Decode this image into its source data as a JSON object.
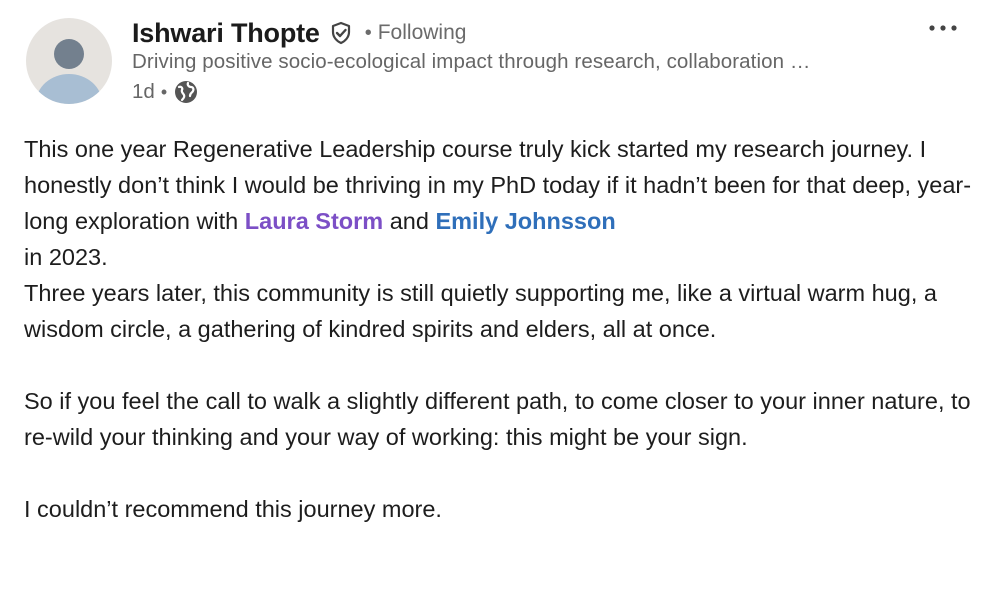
{
  "author": {
    "name": "Ishwari Thopte",
    "following": "Following",
    "headline": "Driving positive socio-ecological impact through research, collaboration …",
    "time": "1d",
    "verified_icon": "verified-shield-icon",
    "visibility_icon": "globe-icon"
  },
  "menu": {
    "more_icon": "more-horizontal-icon"
  },
  "post": {
    "p1_a": "This one year Regenerative Leadership course truly kick started my research journey. I honestly don’t think I would be thriving in my PhD today if it hadn’t been for that deep, year-long exploration with ",
    "mention_1": "Laura Storm",
    "p1_b": " and ",
    "mention_2": "Emily Johnsson",
    "p1_c": " in 2023.",
    "p2": "Three years later, this community is still quietly supporting me, like a virtual warm hug, a wisdom circle, a gathering of kindred spirits and elders, all at once.",
    "p3": "So if you feel the call to walk a slightly different path, to come closer to your inner nature, to re-wild your thinking and your way of working: this might be your sign.",
    "p4": "I couldn’t recommend this journey more."
  },
  "colors": {
    "mention_purple": "#7c4fc6",
    "mention_blue": "#2f6fba",
    "meta_gray": "#666666"
  }
}
